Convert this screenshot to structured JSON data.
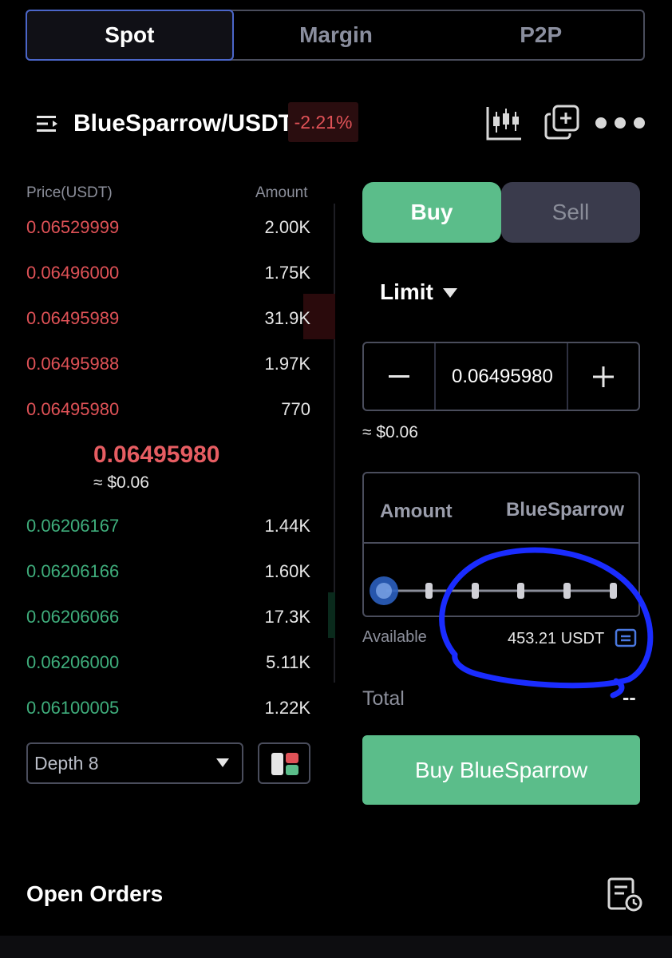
{
  "tabs": [
    {
      "label": "Spot",
      "active": true
    },
    {
      "label": "Margin",
      "active": false
    },
    {
      "label": "P2P",
      "active": false
    }
  ],
  "header": {
    "pair": "BlueSparrow/USDT",
    "change": "-2.21%",
    "icons": [
      "menu-icon",
      "candlestick-chart-icon",
      "add-copy-icon",
      "more-icon"
    ]
  },
  "orderbook": {
    "price_header": "Price(USDT)",
    "amount_header": "Amount",
    "asks": [
      {
        "price": "0.06529999",
        "amount": "2.00K"
      },
      {
        "price": "0.06496000",
        "amount": "1.75K"
      },
      {
        "price": "0.06495989",
        "amount": "31.9K"
      },
      {
        "price": "0.06495988",
        "amount": "1.97K"
      },
      {
        "price": "0.06495980",
        "amount": "770"
      }
    ],
    "mid_price": "0.06495980",
    "mid_usd": "≈ $0.06",
    "bids": [
      {
        "price": "0.06206167",
        "amount": "1.44K"
      },
      {
        "price": "0.06206166",
        "amount": "1.60K"
      },
      {
        "price": "0.06206066",
        "amount": "17.3K"
      },
      {
        "price": "0.06206000",
        "amount": "5.11K"
      },
      {
        "price": "0.06100005",
        "amount": "1.22K"
      }
    ],
    "depth_label": "Depth 8"
  },
  "trade": {
    "buy_label": "Buy",
    "sell_label": "Sell",
    "order_type": "Limit",
    "price_value": "0.06495980",
    "price_approx": "≈ $0.06",
    "amount_label": "Amount",
    "amount_unit": "BlueSparrow",
    "slider_level": 0,
    "available_label": "Available",
    "available_value": "453.21 USDT",
    "total_label": "Total",
    "total_value": "--",
    "submit_label": "Buy BlueSparrow"
  },
  "footer": {
    "open_orders": "Open Orders"
  },
  "colors": {
    "ask": "#e05257",
    "bid": "#3fae7c",
    "buy": "#5bbd8a",
    "sell_bg": "#3a3b4c",
    "annotation": "#1a2cff"
  }
}
